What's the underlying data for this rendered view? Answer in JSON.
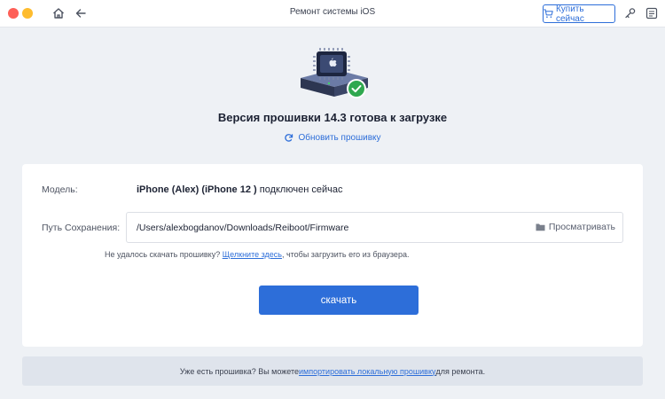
{
  "window": {
    "title": "Ремонт системы iOS",
    "buy_label": "Купить сейчас"
  },
  "icons": {
    "home": "home-icon",
    "back": "arrow-left-icon",
    "cart": "cart-icon",
    "key": "key-icon",
    "menu": "menu-icon",
    "refresh": "refresh-icon",
    "folder": "folder-icon",
    "chip": "firmware-chip-icon",
    "check": "check-badge-icon"
  },
  "main": {
    "headline": "Версия прошивки 14.3 готова к загрузке",
    "refresh_label": "Обновить прошивку"
  },
  "card": {
    "model_label": "Модель:",
    "model_device": "iPhone (Alex) (iPhone 12 )",
    "model_status": " подключен сейчас",
    "path_label": "Путь Сохранения:",
    "path_value": "/Users/alexbogdanov/Downloads/Reiboot/Firmware",
    "browse_label": "Просматривать",
    "hint_prefix": "Не удалось скачать прошивку? ",
    "hint_link": "Щелкните здесь",
    "hint_suffix": ", чтобы загрузить его из браузера.",
    "download_label": "скачать"
  },
  "footer": {
    "prefix": "Уже есть прошивка? Вы можете ",
    "link": "импортировать локальную прошивку",
    "suffix": " для ремонта."
  },
  "colors": {
    "accent": "#2d6ed9",
    "success": "#2fa84f",
    "background": "#eef1f5"
  }
}
